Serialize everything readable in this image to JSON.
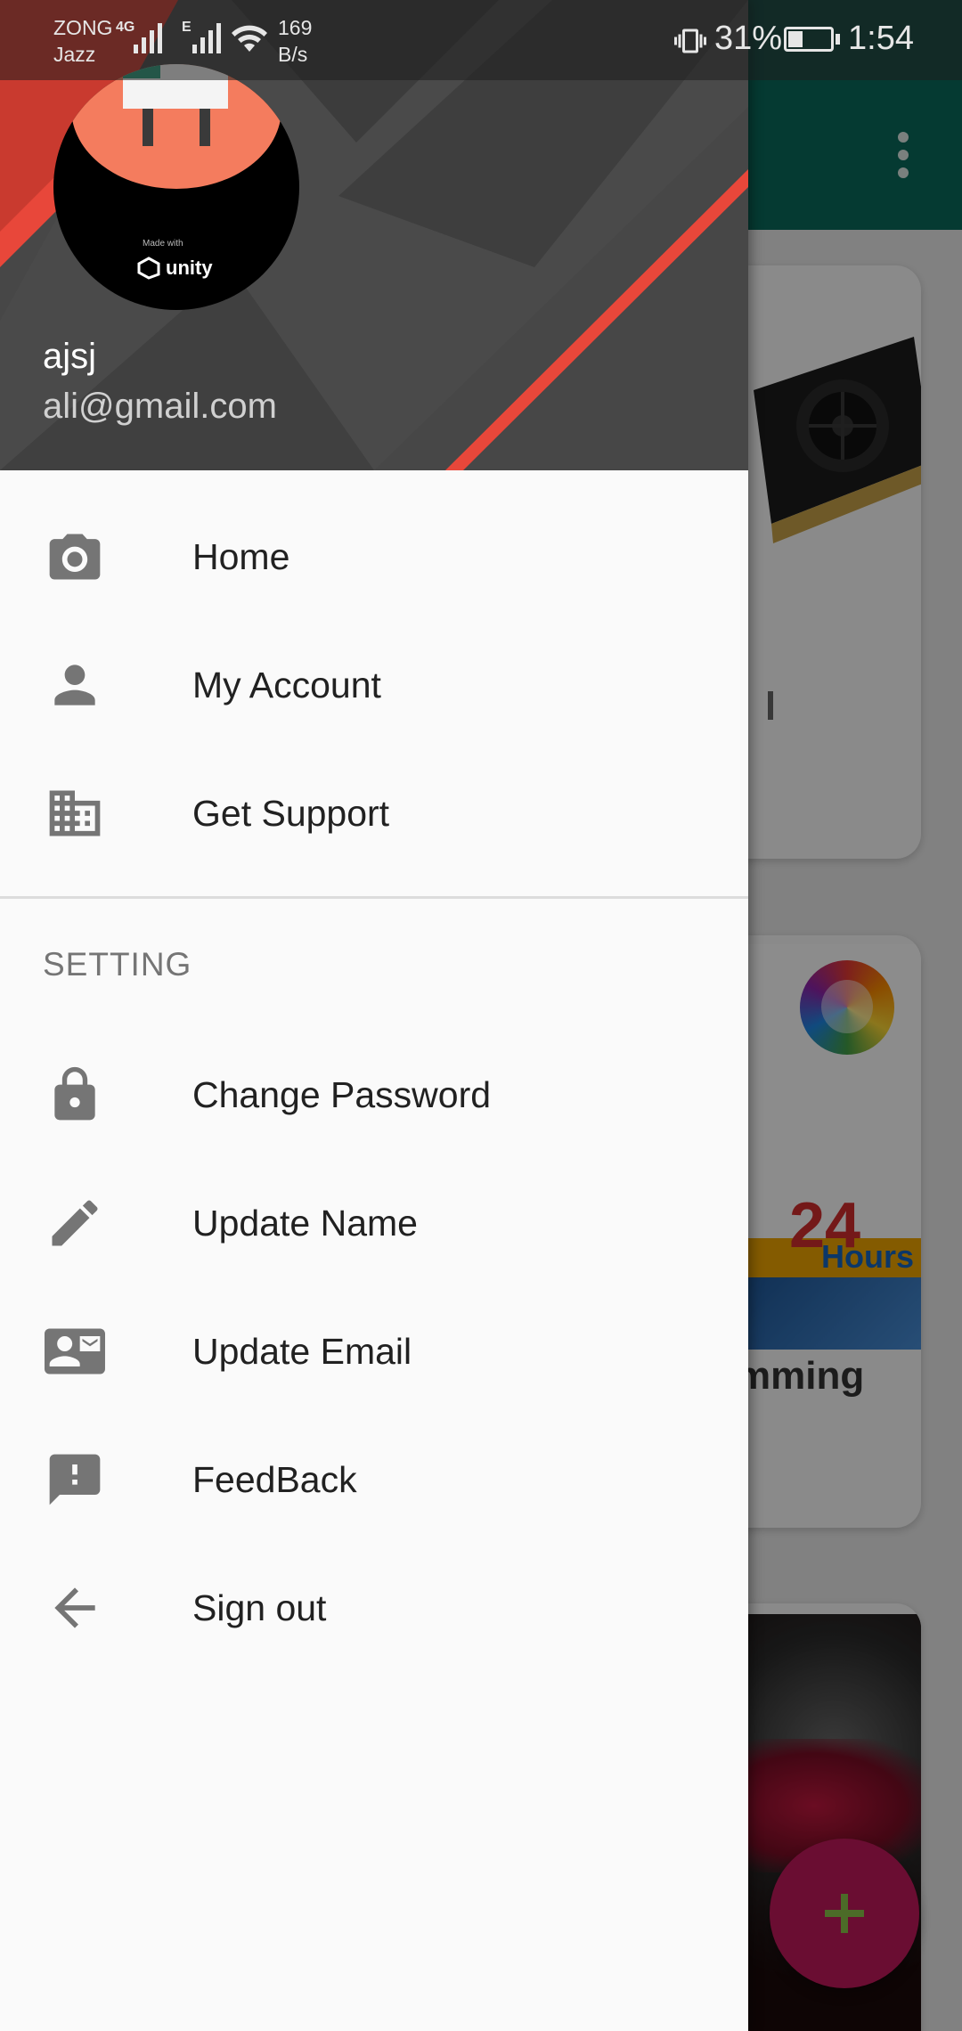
{
  "status_bar": {
    "carrier_top": "ZONG",
    "carrier_bottom": "Jazz",
    "network_4g": "4G",
    "network_e": "E",
    "speed_value": "169",
    "speed_unit": "B/s",
    "battery": "31%",
    "time": "1:54"
  },
  "background": {
    "card2_title_fragment": "mming",
    "book_number": "24",
    "book_word": "Hours",
    "fab_icon": "plus-icon",
    "overflow_icon": "more-vert-icon"
  },
  "drawer": {
    "header": {
      "avatar_text": "unity",
      "avatar_subtext": "Made with",
      "user_name": "ajsj",
      "user_email": "ali@gmail.com"
    },
    "primary_items": [
      {
        "label": "Home",
        "icon": "camera-icon"
      },
      {
        "label": "My Account",
        "icon": "person-icon"
      },
      {
        "label": "Get Support",
        "icon": "business-icon"
      }
    ],
    "section_title": "SETTING",
    "setting_items": [
      {
        "label": "Change Password",
        "icon": "lock-icon"
      },
      {
        "label": "Update Name",
        "icon": "pencil-icon"
      },
      {
        "label": "Update Email",
        "icon": "contact-mail-icon"
      },
      {
        "label": "FeedBack",
        "icon": "feedback-icon"
      },
      {
        "label": "Sign out",
        "icon": "arrow-back-icon"
      }
    ]
  },
  "colors": {
    "toolbar": "#0a6b5c",
    "fab": "#c2185b",
    "accent_red": "#e8473a",
    "drawer_bg": "#fafafa",
    "icon_gray": "#757575"
  }
}
